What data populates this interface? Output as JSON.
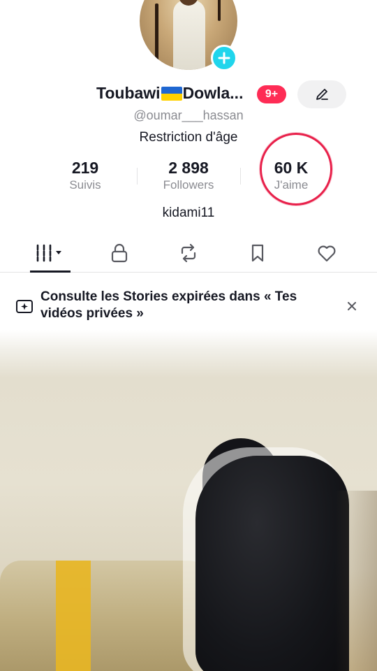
{
  "profile": {
    "name_part1": "Toubawi",
    "name_part2": "Dowla...",
    "flag_icon": "ukraine-flag-emoji",
    "notification_badge": "9+",
    "handle": "@oumar___hassan",
    "age_restriction": "Restriction d'âge",
    "bio": "kidami11"
  },
  "stats": [
    {
      "value": "219",
      "label": "Suivis"
    },
    {
      "value": "2 898",
      "label": "Followers"
    },
    {
      "value": "60 K",
      "label": "J'aime"
    }
  ],
  "tabs": [
    {
      "icon": "grid-icon",
      "active": true
    },
    {
      "icon": "lock-icon",
      "active": false
    },
    {
      "icon": "repost-icon",
      "active": false
    },
    {
      "icon": "bookmark-icon",
      "active": false
    },
    {
      "icon": "heart-icon",
      "active": false
    }
  ],
  "banner": {
    "text": "Consulte les Stories expirées dans « Tes vidéos privées »"
  },
  "colors": {
    "badge": "#fe2c55",
    "plus": "#20d5ec",
    "highlight_circle": "#e8204a"
  }
}
